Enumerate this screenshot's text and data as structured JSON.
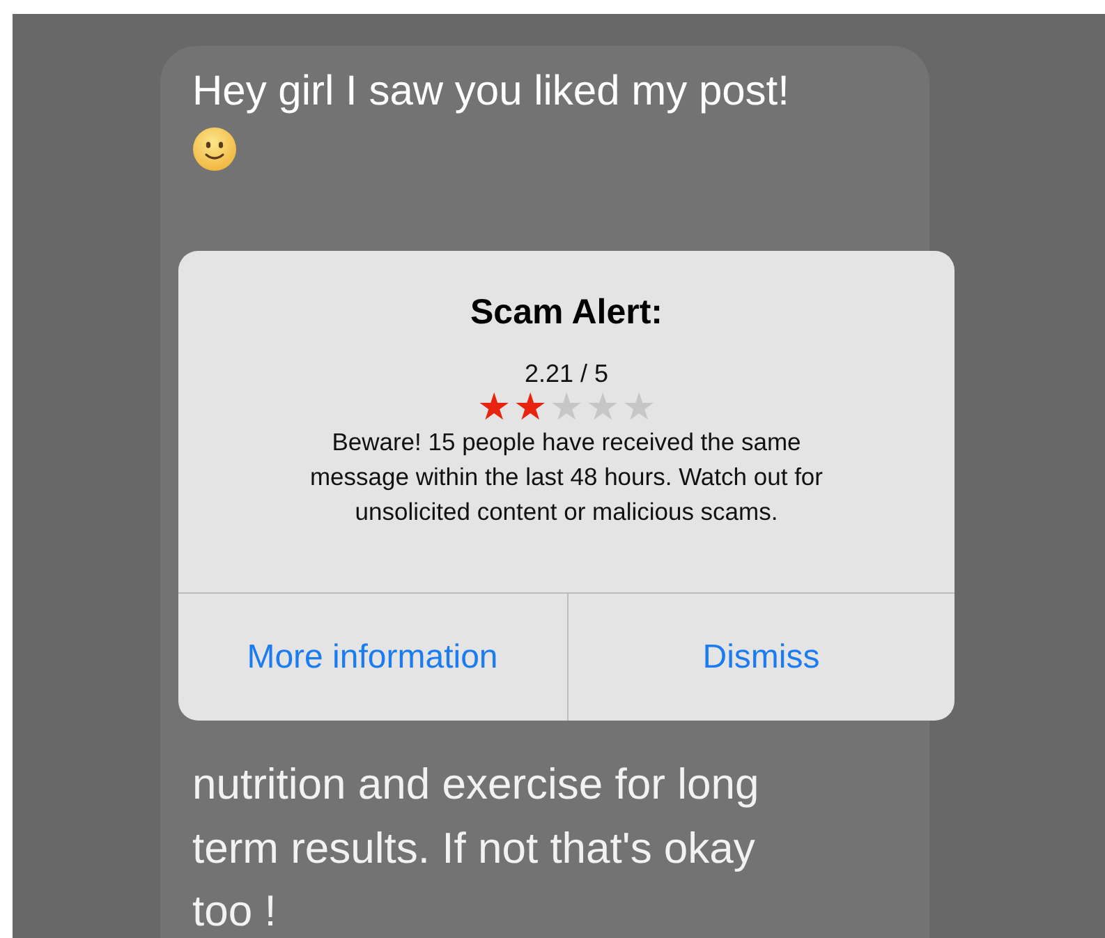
{
  "message": {
    "first_line": "Hey girl I saw you liked my post!",
    "lines": [
      "nutrition and exercise for long",
      "term results. If not that's okay",
      "too !"
    ]
  },
  "alert": {
    "title": "Scam Alert:",
    "rating": "2.21 / 5",
    "stars": 2,
    "text": "Beware! 15 people have received the same message within the last 48 hours. Watch out for unsolicited content or malicious scams.",
    "buttons": [
      {
        "label": "More information"
      },
      {
        "label": "Dismiss"
      }
    ]
  }
}
